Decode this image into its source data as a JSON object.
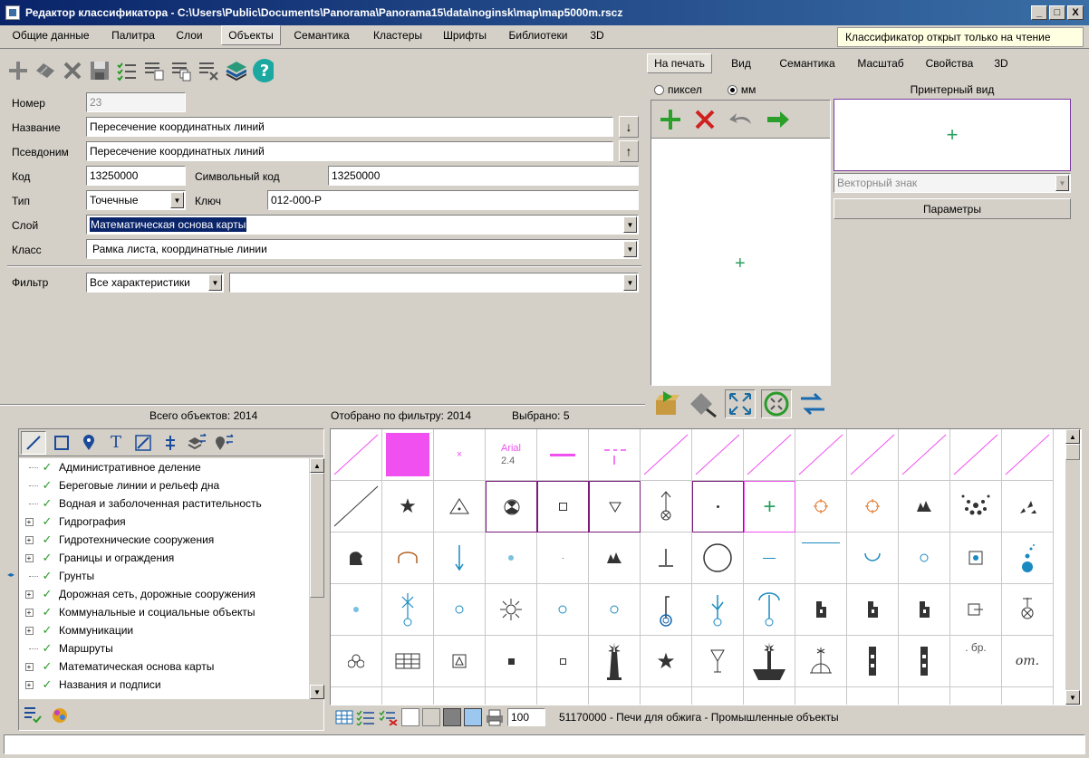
{
  "window": {
    "title": "Редактор классификатора - C:\\Users\\Public\\Documents\\Panorama\\Panorama15\\data\\noginsk\\map\\map5000m.rscz",
    "controls": [
      "_",
      "□",
      "X"
    ]
  },
  "main_tabs": [
    "Общие данные",
    "Палитра",
    "Слои",
    "Объекты",
    "Семантика",
    "Кластеры",
    "Шрифты",
    "Библиотеки",
    "3D"
  ],
  "readonly_banner": "Классификатор открыт только на чтение",
  "form": {
    "number_label": "Номер",
    "number_value": "23",
    "name_label": "Название",
    "name_value": "Пересечение координатных линий",
    "alias_label": "Псевдоним",
    "alias_value": "Пересечение координатных линий",
    "code_label": "Код",
    "code_value": "13250000",
    "symcode_label": "Символьный код",
    "symcode_value": "13250000",
    "type_label": "Тип",
    "type_value": "Точечные",
    "key_label": "Ключ",
    "key_value": "012-000-P",
    "layer_label": "Слой",
    "layer_value": "Математическая основа карты",
    "class_label": "Класс",
    "class_value": "Рамка листа, координатные линии",
    "filter_label": "Фильтр",
    "filter_value": "Все характеристики",
    "filter_value2": ""
  },
  "stats": {
    "total": "Всего объектов: 2014",
    "filtered": "Отобрано по фильтру: 2014",
    "selected": "Выбрано: 5"
  },
  "right_tabs": [
    "На печать",
    "Вид",
    "Семантика",
    "Масштаб",
    "Свойства",
    "3D"
  ],
  "units": {
    "pixel": "пиксел",
    "mm": "мм"
  },
  "printer_view": {
    "title": "Принтерный вид",
    "sign_type": "Векторный знак",
    "params_button": "Параметры"
  },
  "tree": [
    {
      "label": "Административное деление",
      "expandable": false
    },
    {
      "label": "Береговые линии и рельеф дна",
      "expandable": false
    },
    {
      "label": "Водная и заболоченная растительность",
      "expandable": false
    },
    {
      "label": "Гидрография",
      "expandable": true
    },
    {
      "label": "Гидротехнические сооружения",
      "expandable": true
    },
    {
      "label": "Границы и ограждения",
      "expandable": true
    },
    {
      "label": "Грунты",
      "expandable": false
    },
    {
      "label": "Дорожная сеть, дорожные сооружения",
      "expandable": true
    },
    {
      "label": "Коммунальные и социальные объекты",
      "expandable": true
    },
    {
      "label": "Коммуникации",
      "expandable": true
    },
    {
      "label": "Маршруты",
      "expandable": false
    },
    {
      "label": "Математическая основа карты",
      "expandable": true
    },
    {
      "label": "Названия и подписи",
      "expandable": true
    }
  ],
  "grid_text": {
    "arial": "Arial",
    "size": "2.4",
    "br": ". бр.",
    "ot": "от."
  },
  "bottom": {
    "zoom": "100",
    "status": "51170000 - Печи для обжига - Промышленные объекты"
  },
  "colors": {
    "accent_pink": "#f050f0",
    "title_blue": "#0a246a",
    "green": "#2a9a2a",
    "red": "#d02020"
  }
}
